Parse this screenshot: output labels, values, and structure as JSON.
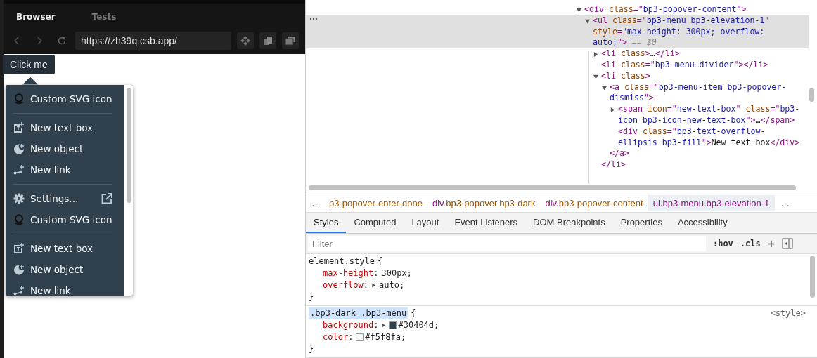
{
  "preview": {
    "tabs": [
      {
        "label": "Browser",
        "selected": true
      },
      {
        "label": "Tests",
        "selected": false
      }
    ],
    "url": "https://zh39q.csb.app/",
    "button": "Click me",
    "menu": [
      {
        "kind": "custom",
        "label": "Custom SVG icon"
      },
      {
        "kind": "divider"
      },
      {
        "kind": "textbox",
        "label": "New text box"
      },
      {
        "kind": "object",
        "label": "New object"
      },
      {
        "kind": "link",
        "label": "New link"
      },
      {
        "kind": "divider"
      },
      {
        "kind": "settings",
        "label": "Settings...",
        "external": true
      },
      {
        "kind": "custom",
        "label": "Custom SVG icon"
      },
      {
        "kind": "divider"
      },
      {
        "kind": "textbox",
        "label": "New text box"
      },
      {
        "kind": "object",
        "label": "New object"
      },
      {
        "kind": "link",
        "label": "New link"
      }
    ]
  },
  "dom_tree": {
    "children": [
      {
        "kind": "parent",
        "expanded": true,
        "selected": false,
        "open": [
          {
            "kind": "tag",
            "t": "<div "
          },
          {
            "kind": "attr",
            "t": "class"
          },
          {
            "kind": "tag",
            "t": "=\""
          },
          {
            "kind": "val",
            "t": "bp3-popover-content"
          },
          {
            "kind": "tag",
            "t": "\">"
          }
        ],
        "children": [
          {
            "kind": "parent",
            "expanded": true,
            "selected": true,
            "open": [
              {
                "kind": "tag",
                "t": "<ul "
              },
              {
                "kind": "attr",
                "t": "class"
              },
              {
                "kind": "tag",
                "t": "=\""
              },
              {
                "kind": "val",
                "t": "bp3-menu bp3-elevation-1"
              },
              {
                "kind": "tag",
                "t": "\" "
              },
              {
                "kind": "attr",
                "t": "style"
              },
              {
                "kind": "tag",
                "t": "=\""
              },
              {
                "kind": "val",
                "t": "max-height: 300px; overflow: auto;"
              },
              {
                "kind": "tag",
                "t": "\">"
              },
              {
                "kind": "dim",
                "t": " == $0"
              }
            ],
            "children": [
              {
                "kind": "parent",
                "expanded": false,
                "selected": false,
                "open": [
                  {
                    "kind": "tag",
                    "t": "<li "
                  },
                  {
                    "kind": "attr",
                    "t": "class"
                  },
                  {
                    "kind": "tag",
                    "t": ">"
                  },
                  {
                    "kind": "text",
                    "t": "…"
                  },
                  {
                    "kind": "tag",
                    "t": "</li>"
                  }
                ]
              },
              {
                "kind": "leaf",
                "selected": false,
                "open": [
                  {
                    "kind": "tag",
                    "t": "<li "
                  },
                  {
                    "kind": "attr",
                    "t": "class"
                  },
                  {
                    "kind": "tag",
                    "t": "=\""
                  },
                  {
                    "kind": "val",
                    "t": "bp3-menu-divider"
                  },
                  {
                    "kind": "tag",
                    "t": "\"></li>"
                  }
                ]
              },
              {
                "kind": "parent",
                "expanded": true,
                "selected": false,
                "open": [
                  {
                    "kind": "tag",
                    "t": "<li "
                  },
                  {
                    "kind": "attr",
                    "t": "class"
                  },
                  {
                    "kind": "tag",
                    "t": ">"
                  }
                ],
                "close": [
                  {
                    "kind": "tag",
                    "t": "</li>"
                  }
                ],
                "children": [
                  {
                    "kind": "parent",
                    "expanded": true,
                    "selected": false,
                    "open": [
                      {
                        "kind": "tag",
                        "t": "<a "
                      },
                      {
                        "kind": "attr",
                        "t": "class"
                      },
                      {
                        "kind": "tag",
                        "t": "=\""
                      },
                      {
                        "kind": "val",
                        "t": "bp3-menu-item bp3-popover-dismiss"
                      },
                      {
                        "kind": "tag",
                        "t": "\">"
                      }
                    ],
                    "close": [
                      {
                        "kind": "tag",
                        "t": "</a>"
                      }
                    ],
                    "children": [
                      {
                        "kind": "parent",
                        "expanded": false,
                        "selected": false,
                        "open": [
                          {
                            "kind": "tag",
                            "t": "<span "
                          },
                          {
                            "kind": "attr",
                            "t": "icon"
                          },
                          {
                            "kind": "tag",
                            "t": "=\""
                          },
                          {
                            "kind": "val",
                            "t": "new-text-box"
                          },
                          {
                            "kind": "tag",
                            "t": "\" "
                          },
                          {
                            "kind": "attr",
                            "t": "class"
                          },
                          {
                            "kind": "tag",
                            "t": "=\""
                          },
                          {
                            "kind": "val",
                            "t": "bp3-icon bp3-icon-new-text-box"
                          },
                          {
                            "kind": "tag",
                            "t": "\">"
                          },
                          {
                            "kind": "text",
                            "t": "…"
                          },
                          {
                            "kind": "tag",
                            "t": "</span>"
                          }
                        ]
                      },
                      {
                        "kind": "leaf",
                        "selected": false,
                        "open": [
                          {
                            "kind": "tag",
                            "t": "<div "
                          },
                          {
                            "kind": "attr",
                            "t": "class"
                          },
                          {
                            "kind": "tag",
                            "t": "=\""
                          },
                          {
                            "kind": "val",
                            "t": "bp3-text-overflow-ellipsis bp3-fill"
                          },
                          {
                            "kind": "tag",
                            "t": "\">"
                          },
                          {
                            "kind": "text",
                            "t": "New text box"
                          },
                          {
                            "kind": "tag",
                            "t": "</div>"
                          }
                        ]
                      }
                    ]
                  }
                ]
              }
            ]
          }
        ]
      }
    ]
  },
  "breadcrumbs": [
    {
      "classes": "p3-popover-enter-done",
      "selected": false
    },
    {
      "tag": "div",
      "classes": ".bp3-popover.bp3-dark",
      "selected": false
    },
    {
      "tag": "div",
      "classes": ".bp3-popover-content",
      "selected": false
    },
    {
      "tag": "ul",
      "classes": ".bp3-menu.bp3-elevation-1",
      "selected": true
    }
  ],
  "tabs": [
    {
      "label": "Styles",
      "selected": true
    },
    {
      "label": "Computed",
      "selected": false
    },
    {
      "label": "Layout",
      "selected": false
    },
    {
      "label": "Event Listeners",
      "selected": false
    },
    {
      "label": "DOM Breakpoints",
      "selected": false
    },
    {
      "label": "Properties",
      "selected": false
    },
    {
      "label": "Accessibility",
      "selected": false
    }
  ],
  "filter": {
    "placeholder": "Filter",
    "hov": ":hov",
    "cls": ".cls",
    "add": "+"
  },
  "rules": [
    {
      "selector": "element.style",
      "open": "{",
      "close": "}",
      "highlighted": false,
      "declarations": [
        {
          "text": "max-height: 300px;",
          "expandable": false
        },
        {
          "text": "overflow: auto;",
          "expandable": true
        }
      ]
    },
    {
      "selector": ".bp3-dark .bp3-menu",
      "open": "{",
      "close": "}",
      "highlighted": true,
      "source": "<style>",
      "declarations": [
        {
          "text": "background: #30404d;",
          "expandable": true,
          "color": "#30404d"
        },
        {
          "text": "color: #f5f8fa;",
          "expandable": false,
          "color": "#f5f8fa"
        }
      ]
    }
  ]
}
